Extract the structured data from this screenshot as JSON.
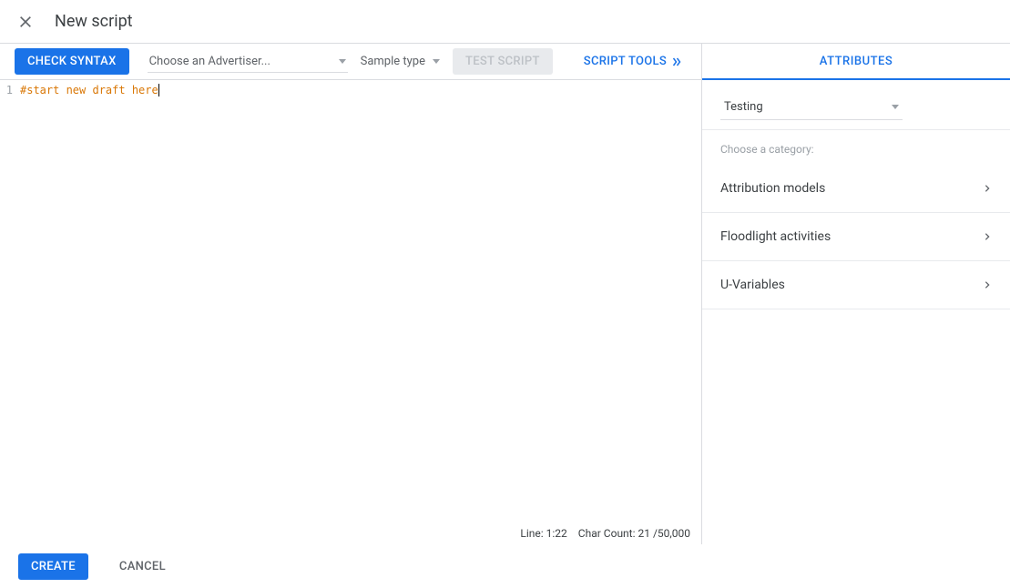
{
  "header": {
    "title": "New script"
  },
  "toolbar": {
    "check_syntax": "CHECK SYNTAX",
    "advertiser_placeholder": "Choose an Advertiser...",
    "sample_type": "Sample type",
    "test_script": "TEST SCRIPT",
    "script_tools": "SCRIPT TOOLS"
  },
  "editor": {
    "line_number": "1",
    "code": "#start new draft here"
  },
  "status": {
    "line": "Line: 1:22",
    "chars": "Char Count: 21 /50,000"
  },
  "panel": {
    "tab": "ATTRIBUTES",
    "select_value": "Testing",
    "category_label": "Choose a category:",
    "categories": [
      "Attribution models",
      "Floodlight activities",
      "U-Variables"
    ]
  },
  "footer": {
    "create": "CREATE",
    "cancel": "CANCEL"
  }
}
